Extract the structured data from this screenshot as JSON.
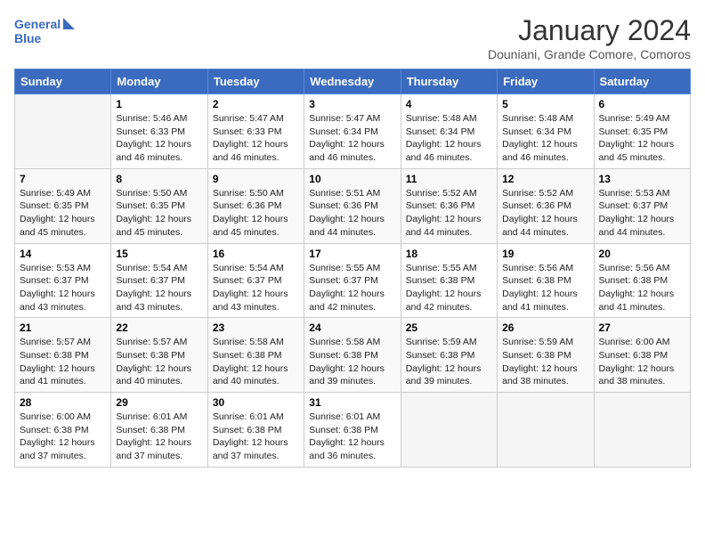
{
  "logo": {
    "line1": "General",
    "line2": "Blue"
  },
  "title": "January 2024",
  "location": "Douniani, Grande Comore, Comoros",
  "days_of_week": [
    "Sunday",
    "Monday",
    "Tuesday",
    "Wednesday",
    "Thursday",
    "Friday",
    "Saturday"
  ],
  "weeks": [
    [
      {
        "day": "",
        "info": ""
      },
      {
        "day": "1",
        "info": "Sunrise: 5:46 AM\nSunset: 6:33 PM\nDaylight: 12 hours\nand 46 minutes."
      },
      {
        "day": "2",
        "info": "Sunrise: 5:47 AM\nSunset: 6:33 PM\nDaylight: 12 hours\nand 46 minutes."
      },
      {
        "day": "3",
        "info": "Sunrise: 5:47 AM\nSunset: 6:34 PM\nDaylight: 12 hours\nand 46 minutes."
      },
      {
        "day": "4",
        "info": "Sunrise: 5:48 AM\nSunset: 6:34 PM\nDaylight: 12 hours\nand 46 minutes."
      },
      {
        "day": "5",
        "info": "Sunrise: 5:48 AM\nSunset: 6:34 PM\nDaylight: 12 hours\nand 46 minutes."
      },
      {
        "day": "6",
        "info": "Sunrise: 5:49 AM\nSunset: 6:35 PM\nDaylight: 12 hours\nand 45 minutes."
      }
    ],
    [
      {
        "day": "7",
        "info": "Sunrise: 5:49 AM\nSunset: 6:35 PM\nDaylight: 12 hours\nand 45 minutes."
      },
      {
        "day": "8",
        "info": "Sunrise: 5:50 AM\nSunset: 6:35 PM\nDaylight: 12 hours\nand 45 minutes."
      },
      {
        "day": "9",
        "info": "Sunrise: 5:50 AM\nSunset: 6:36 PM\nDaylight: 12 hours\nand 45 minutes."
      },
      {
        "day": "10",
        "info": "Sunrise: 5:51 AM\nSunset: 6:36 PM\nDaylight: 12 hours\nand 44 minutes."
      },
      {
        "day": "11",
        "info": "Sunrise: 5:52 AM\nSunset: 6:36 PM\nDaylight: 12 hours\nand 44 minutes."
      },
      {
        "day": "12",
        "info": "Sunrise: 5:52 AM\nSunset: 6:36 PM\nDaylight: 12 hours\nand 44 minutes."
      },
      {
        "day": "13",
        "info": "Sunrise: 5:53 AM\nSunset: 6:37 PM\nDaylight: 12 hours\nand 44 minutes."
      }
    ],
    [
      {
        "day": "14",
        "info": "Sunrise: 5:53 AM\nSunset: 6:37 PM\nDaylight: 12 hours\nand 43 minutes."
      },
      {
        "day": "15",
        "info": "Sunrise: 5:54 AM\nSunset: 6:37 PM\nDaylight: 12 hours\nand 43 minutes."
      },
      {
        "day": "16",
        "info": "Sunrise: 5:54 AM\nSunset: 6:37 PM\nDaylight: 12 hours\nand 43 minutes."
      },
      {
        "day": "17",
        "info": "Sunrise: 5:55 AM\nSunset: 6:37 PM\nDaylight: 12 hours\nand 42 minutes."
      },
      {
        "day": "18",
        "info": "Sunrise: 5:55 AM\nSunset: 6:38 PM\nDaylight: 12 hours\nand 42 minutes."
      },
      {
        "day": "19",
        "info": "Sunrise: 5:56 AM\nSunset: 6:38 PM\nDaylight: 12 hours\nand 41 minutes."
      },
      {
        "day": "20",
        "info": "Sunrise: 5:56 AM\nSunset: 6:38 PM\nDaylight: 12 hours\nand 41 minutes."
      }
    ],
    [
      {
        "day": "21",
        "info": "Sunrise: 5:57 AM\nSunset: 6:38 PM\nDaylight: 12 hours\nand 41 minutes."
      },
      {
        "day": "22",
        "info": "Sunrise: 5:57 AM\nSunset: 6:38 PM\nDaylight: 12 hours\nand 40 minutes."
      },
      {
        "day": "23",
        "info": "Sunrise: 5:58 AM\nSunset: 6:38 PM\nDaylight: 12 hours\nand 40 minutes."
      },
      {
        "day": "24",
        "info": "Sunrise: 5:58 AM\nSunset: 6:38 PM\nDaylight: 12 hours\nand 39 minutes."
      },
      {
        "day": "25",
        "info": "Sunrise: 5:59 AM\nSunset: 6:38 PM\nDaylight: 12 hours\nand 39 minutes."
      },
      {
        "day": "26",
        "info": "Sunrise: 5:59 AM\nSunset: 6:38 PM\nDaylight: 12 hours\nand 38 minutes."
      },
      {
        "day": "27",
        "info": "Sunrise: 6:00 AM\nSunset: 6:38 PM\nDaylight: 12 hours\nand 38 minutes."
      }
    ],
    [
      {
        "day": "28",
        "info": "Sunrise: 6:00 AM\nSunset: 6:38 PM\nDaylight: 12 hours\nand 37 minutes."
      },
      {
        "day": "29",
        "info": "Sunrise: 6:01 AM\nSunset: 6:38 PM\nDaylight: 12 hours\nand 37 minutes."
      },
      {
        "day": "30",
        "info": "Sunrise: 6:01 AM\nSunset: 6:38 PM\nDaylight: 12 hours\nand 37 minutes."
      },
      {
        "day": "31",
        "info": "Sunrise: 6:01 AM\nSunset: 6:38 PM\nDaylight: 12 hours\nand 36 minutes."
      },
      {
        "day": "",
        "info": ""
      },
      {
        "day": "",
        "info": ""
      },
      {
        "day": "",
        "info": ""
      }
    ]
  ]
}
